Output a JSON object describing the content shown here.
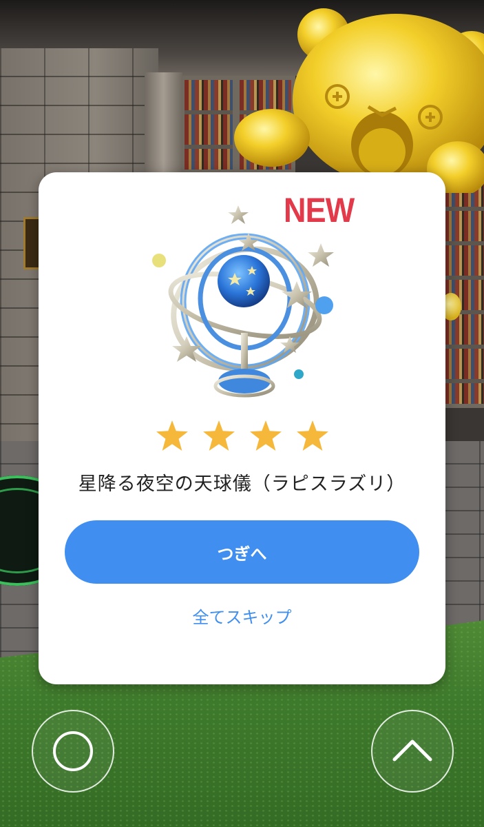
{
  "modal": {
    "badge": "NEW",
    "rating": 4,
    "item_name": "星降る夜空の天球儀（ラピスラズリ）",
    "next_label": "つぎへ",
    "skip_label": "全てスキップ"
  },
  "controls": {
    "left_icon": "circle-icon",
    "right_icon": "chevron-up-icon"
  },
  "colors": {
    "accent": "#3f8ef0",
    "badge": "#e23a4a",
    "star": "#f5b83a"
  }
}
